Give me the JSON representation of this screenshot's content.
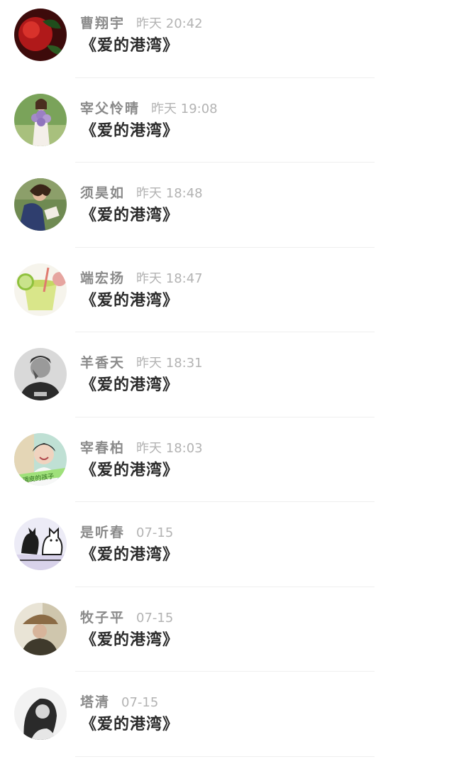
{
  "comments": [
    {
      "name": "曹翔宇",
      "time": "昨天 20:42",
      "message": "《爱的港湾》",
      "avatar": "red-flower-photo"
    },
    {
      "name": "宰父怜晴",
      "time": "昨天 19:08",
      "message": "《爱的港湾》",
      "avatar": "girl-with-lavender-bouquet-photo"
    },
    {
      "name": "须昊如",
      "time": "昨天 18:48",
      "message": "《爱的港湾》",
      "avatar": "girl-reading-book-photo"
    },
    {
      "name": "端宏扬",
      "time": "昨天 18:47",
      "message": "《爱的港湾》",
      "avatar": "lime-drink-photo"
    },
    {
      "name": "羊香天",
      "time": "昨天 18:31",
      "message": "《爱的港湾》",
      "avatar": "grayscale-portrait-photo"
    },
    {
      "name": "宰春柏",
      "time": "昨天 18:03",
      "message": "《爱的港湾》",
      "avatar": "smiling-girl-photo",
      "avatar_text": "个调皮的孩子"
    },
    {
      "name": "是听春",
      "time": "07-15",
      "message": "《爱的港湾》",
      "avatar": "cartoon-cats-drawing"
    },
    {
      "name": "牧子平",
      "time": "07-15",
      "message": "《爱的港湾》",
      "avatar": "person-in-hat-photo"
    },
    {
      "name": "塔清",
      "time": "07-15",
      "message": "《爱的港湾》",
      "avatar": "long-hair-girl-grayscale-photo"
    }
  ]
}
